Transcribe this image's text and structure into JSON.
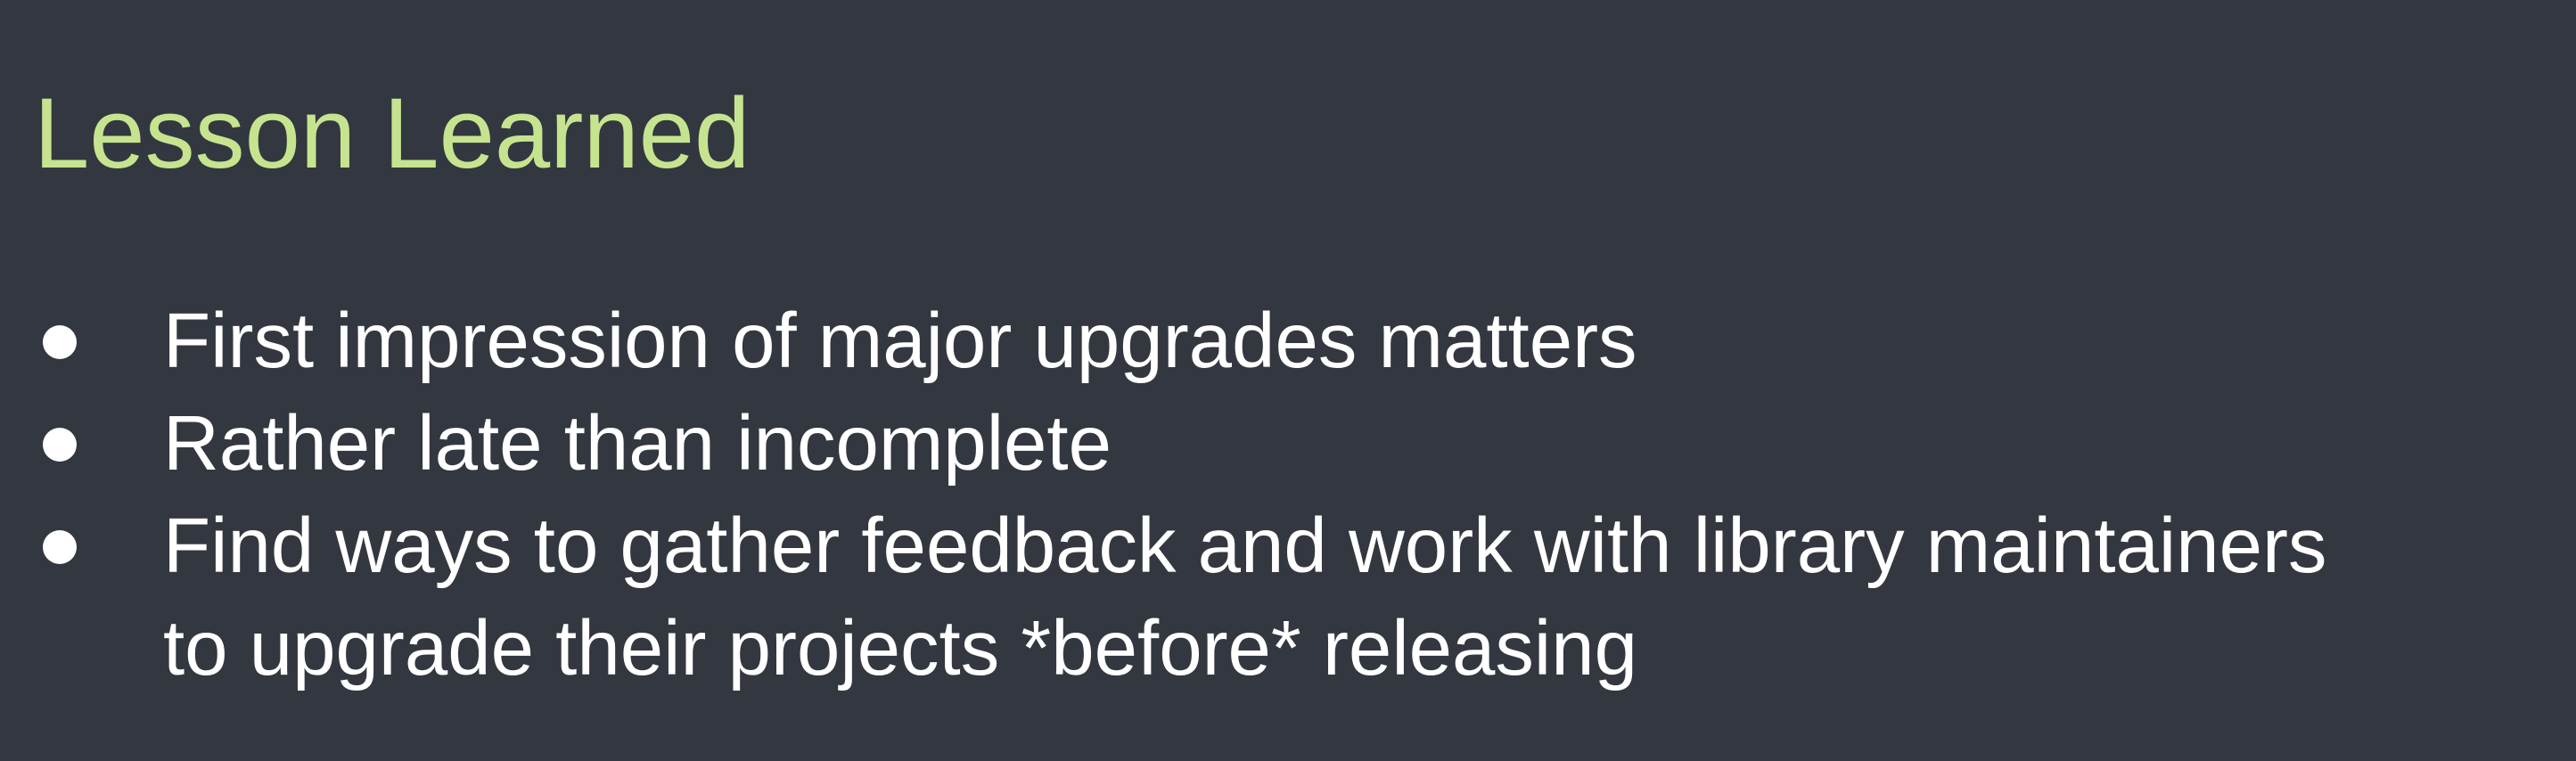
{
  "slide": {
    "title": "Lesson Learned",
    "bullets": [
      {
        "lines": [
          "First impression of major upgrades matters"
        ]
      },
      {
        "lines": [
          "Rather late than incomplete"
        ]
      },
      {
        "lines": [
          "Find ways to gather feedback and work with library maintainers",
          "to upgrade their projects *before* releasing"
        ]
      }
    ]
  },
  "colors": {
    "background": "#333740",
    "title": "#c6e48f",
    "text": "#ffffff"
  }
}
